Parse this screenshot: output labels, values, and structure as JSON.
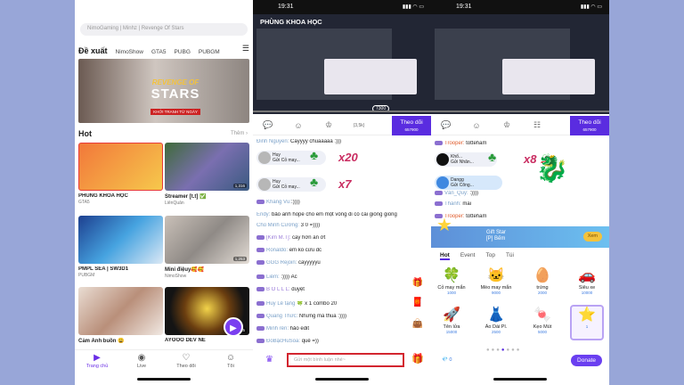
{
  "p1": {
    "search_placeholder": "NimoGaming | Minhz | Revenge Of Stars",
    "tabs": [
      "Đề xuất",
      "NimoShow",
      "GTA5",
      "PUBG",
      "PUBGM"
    ],
    "banner": {
      "line1": "REVENGE OF",
      "line2": "STARS",
      "line3": "KHỞI TRANH TỪ NGÀY"
    },
    "hot_title": "Hot",
    "more": "Thêm ›",
    "cards": [
      {
        "title": "PHÙNG KHOA HỌC",
        "sub": "GTA5",
        "badge": ""
      },
      {
        "title": "Streamer [t.t] ✅",
        "sub": "LiênQuân",
        "badge": "1,316"
      },
      {
        "title": "PMPL SEA | SW3D1",
        "sub": "PUBGM",
        "badge": ""
      },
      {
        "title": "Mini điệuy🥰🥰",
        "sub": "NimoShow",
        "badge": "1,253"
      },
      {
        "title": "Cảm Anh buồn 😩",
        "sub": "",
        "badge": ""
      },
      {
        "title": "AYOOO DEV NE",
        "sub": "",
        "badge": "1,225"
      }
    ],
    "nav": [
      {
        "icon": "▶",
        "label": "Trang chủ"
      },
      {
        "icon": "◉",
        "label": "Live"
      },
      {
        "icon": "♡",
        "label": "Theo dõi"
      },
      {
        "icon": "☺",
        "label": "Tôi"
      }
    ]
  },
  "p2": {
    "time": "19:31",
    "video_title": "PHÙNG KHOA HỌC",
    "video_time": "7300",
    "follow": {
      "label": "Theo dõi",
      "count": "657900"
    },
    "tab_counts": "(3,5k)",
    "chat": [
      {
        "name": "Đinh Nguyễn:",
        "msg": " Cayyyy chuaaaaa :)))"
      },
      {
        "name": "Endy:",
        "msg": " bảo anh hope cho em một vòng đi có cái giống giống"
      },
      {
        "name": "Chủ Minh Cường:",
        "msg": " 3 0 =))))"
      },
      {
        "name": "[Kim M.T]:",
        "msg": " cay hơn ăn ớt"
      },
      {
        "name": "Ronaldo:",
        "msg": " em ko cứu đc"
      },
      {
        "name": "GGG Rejoin:",
        "msg": " cayyyyyu"
      },
      {
        "name": "Liêm:",
        "msg": " :))))  Ác"
      },
      {
        "name": "B O L L L:",
        "msg": " duyệt"
      },
      {
        "name": "Huy Lê tặng",
        "msg": " 🍀 x 1 combo 20"
      },
      {
        "name": "Quang Thức:",
        "msg": " Nhưng mà thua :))))"
      },
      {
        "name": "Minh rên:",
        "msg": " hảo edit"
      },
      {
        "name": "ĐỗBậcHuSoa:",
        "msg": " quê =))"
      }
    ],
    "gifts": [
      {
        "user": "Huy",
        "sub": "Gửi Cỏ may...",
        "count": "x20"
      },
      {
        "user": "Huy",
        "sub": "Gửi Cỏ may...",
        "count": "x7"
      },
      {
        "user": "Khang Vũ:",
        "sub": ":))))",
        "count": ""
      }
    ],
    "input_placeholder": "Gửi một bình luận nhé~"
  },
  "p3": {
    "time": "19:31",
    "follow": {
      "label": "Theo dõi",
      "count": "657900"
    },
    "chat": [
      {
        "name": "Trooper:",
        "msg": " totteham"
      },
      {
        "name": "Dangg",
        "msg": " Gửi Công..."
      },
      {
        "name": "Vân_Quý:",
        "msg": " :))))"
      },
      {
        "name": "Thành:",
        "msg": " mai"
      },
      {
        "name": "Trooper:",
        "msg": " totteham"
      }
    ],
    "gift_top": {
      "user": "Khổ...",
      "sub": "Gửi Nhãn...",
      "count": "x8"
    },
    "banner": {
      "l1": "Gift Star",
      "l2": "[P] Bếm",
      "go": "Xem"
    },
    "gift_tabs": [
      "Hot",
      "Event",
      "Top",
      "Túi"
    ],
    "gifts": [
      {
        "icon": "🍀",
        "name": "Cỏ may mắn",
        "price": "1000"
      },
      {
        "icon": "🐱",
        "name": "Mèo may mắn",
        "price": "9000"
      },
      {
        "icon": "🥚",
        "name": "trứng",
        "price": "2000"
      },
      {
        "icon": "🚗",
        "name": "Siêu xe",
        "price": "10000"
      },
      {
        "icon": "🚀",
        "name": "Tên lửa",
        "price": "15000"
      },
      {
        "icon": "👗",
        "name": "Áo Dài Pl.",
        "price": "2500"
      },
      {
        "icon": "🍬",
        "name": "Kẹo Mút",
        "price": "5000"
      },
      {
        "icon": "⭐",
        "name": "",
        "price": "1"
      }
    ],
    "coins": "0",
    "donate": "Donate"
  }
}
